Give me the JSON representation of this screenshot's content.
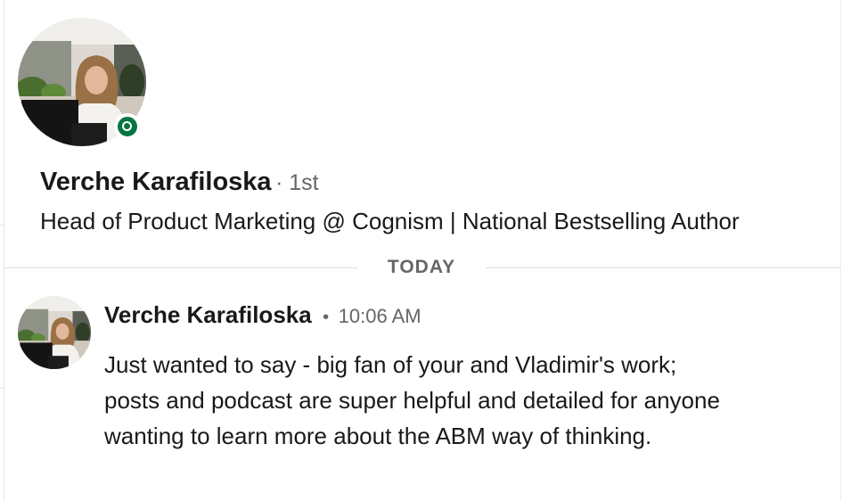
{
  "profile": {
    "name": "Verche Karafiloska",
    "degree": "· 1st",
    "headline": "Head of Product Marketing @ Cognism | National Bestselling Author",
    "presence": "online",
    "presence_color": "#057642"
  },
  "divider": {
    "label": "TODAY"
  },
  "message": {
    "sender": "Verche Karafiloska",
    "separator": "•",
    "time": "10:06 AM",
    "body": "Just wanted to say - big fan of your and Vladimir's work; posts and podcast are super helpful and detailed for anyone wanting to learn more about the ABM way of thinking."
  }
}
